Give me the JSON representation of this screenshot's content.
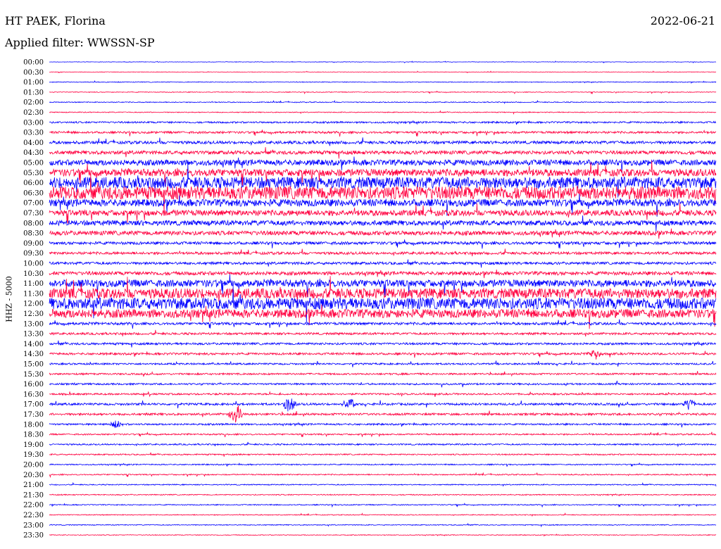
{
  "header": {
    "station": "HT PAEK, Florina",
    "date": "2022-06-21",
    "filter": "Applied filter: WWSSN-SP"
  },
  "chart_data": {
    "type": "line",
    "title": "HT PAEK, Florina",
    "ylabel": "HHZ - 5000",
    "grid": false,
    "legend": "none",
    "colors": [
      "#0000ff",
      "#ff0040"
    ],
    "y_tick_labels": [
      "00:00",
      "00:30",
      "01:00",
      "01:30",
      "02:00",
      "02:30",
      "03:00",
      "03:30",
      "04:00",
      "04:30",
      "05:00",
      "05:30",
      "06:00",
      "06:30",
      "07:00",
      "07:30",
      "08:00",
      "08:30",
      "09:00",
      "09:30",
      "10:00",
      "10:30",
      "11:00",
      "11:30",
      "12:00",
      "12:30",
      "13:00",
      "13:30",
      "14:00",
      "14:30",
      "15:00",
      "15:30",
      "16:00",
      "16:30",
      "17:00",
      "17:30",
      "18:00",
      "18:30",
      "19:00",
      "19:30",
      "20:00",
      "20:30",
      "21:00",
      "21:30",
      "22:00",
      "22:30",
      "23:00",
      "23:30"
    ],
    "row_noise_level": [
      0.3,
      0.3,
      0.5,
      0.5,
      0.6,
      0.6,
      1.2,
      1.5,
      2.0,
      2.5,
      4.0,
      5.0,
      8.0,
      9.0,
      5.0,
      4.0,
      3.5,
      3.0,
      2.0,
      1.8,
      1.8,
      2.5,
      5.0,
      7.0,
      8.0,
      6.0,
      1.8,
      1.5,
      1.5,
      1.5,
      1.2,
      1.2,
      1.2,
      1.2,
      1.5,
      1.5,
      1.2,
      1.0,
      1.0,
      0.9,
      0.8,
      0.8,
      0.7,
      0.7,
      0.7,
      0.6,
      0.6,
      0.5
    ],
    "events": [
      {
        "time": "17:00",
        "rel_x": 0.36,
        "amp": 12
      },
      {
        "time": "17:00",
        "rel_x": 0.45,
        "amp": 10
      },
      {
        "time": "17:30",
        "rel_x": 0.28,
        "amp": 16
      },
      {
        "time": "14:30",
        "rel_x": 0.82,
        "amp": 8
      },
      {
        "time": "18:00",
        "rel_x": 0.1,
        "amp": 6
      },
      {
        "time": "17:00",
        "rel_x": 0.96,
        "amp": 8
      }
    ]
  }
}
